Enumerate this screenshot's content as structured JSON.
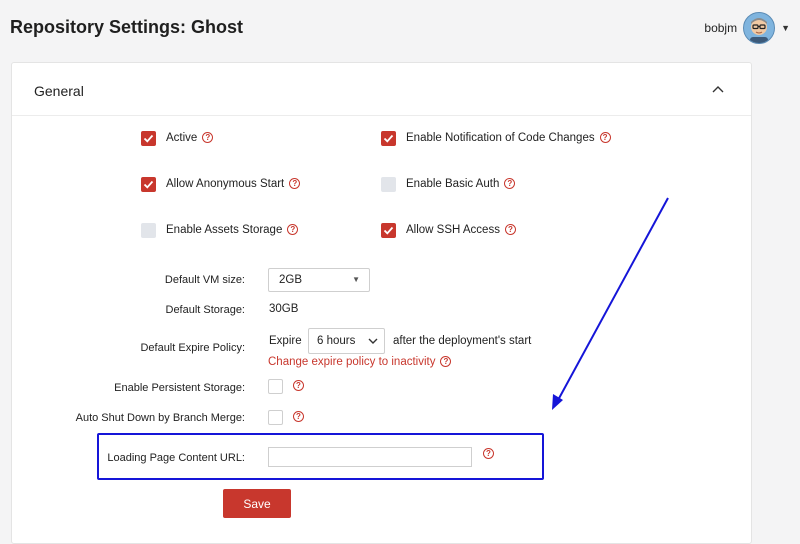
{
  "header": {
    "title": "Repository Settings: Ghost",
    "username": "bobjm"
  },
  "panel": {
    "title": "General"
  },
  "checkboxes": [
    {
      "label": "Active",
      "checked": true
    },
    {
      "label": "Enable Notification of Code Changes",
      "checked": true
    },
    {
      "label": "Allow Anonymous Start",
      "checked": true
    },
    {
      "label": "Enable Basic Auth",
      "checked": false
    },
    {
      "label": "Enable Assets Storage",
      "checked": false
    },
    {
      "label": "Allow SSH Access",
      "checked": true
    }
  ],
  "form": {
    "vm_size_label": "Default VM size:",
    "vm_size_value": "2GB",
    "storage_label": "Default Storage:",
    "storage_value": "30GB",
    "expire_label": "Default Expire Policy:",
    "expire_prefix": "Expire",
    "expire_value": "6 hours",
    "expire_suffix": "after the deployment's start",
    "expire_link": "Change expire policy to inactivity",
    "persistent_label": "Enable Persistent Storage:",
    "auto_shutdown_label": "Auto Shut Down by Branch Merge:",
    "loading_url_label": "Loading Page Content URL:",
    "loading_url_value": "",
    "save_label": "Save"
  },
  "colors": {
    "accent": "#c8372d",
    "annotation": "#1515d8"
  },
  "icons": {
    "help": "?",
    "collapse": "chevron-up-icon"
  }
}
